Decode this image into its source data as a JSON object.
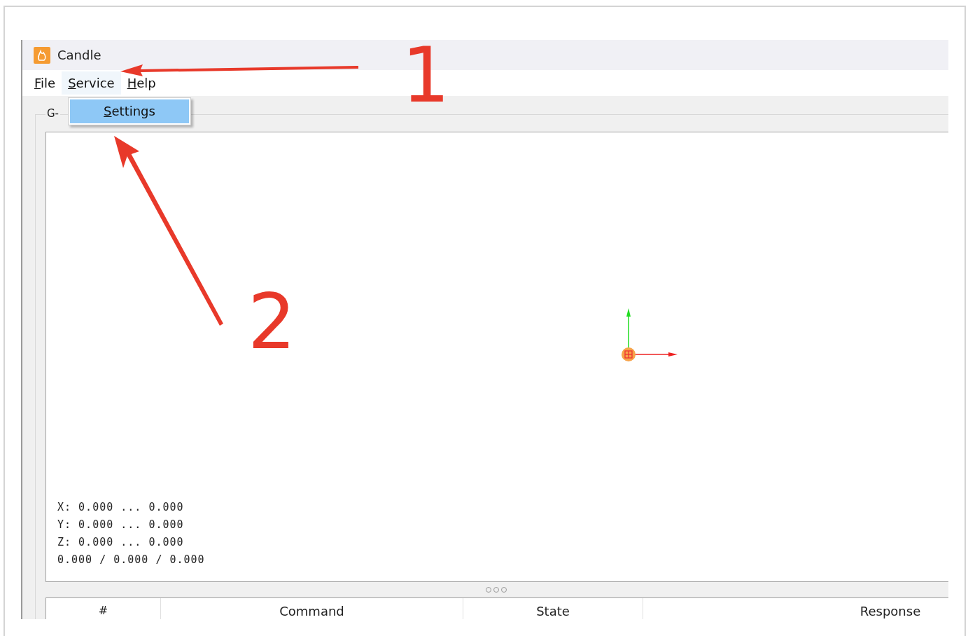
{
  "window": {
    "title": "Candle"
  },
  "menu_bar": [
    {
      "label": "File",
      "mnemonic": true,
      "open": false
    },
    {
      "label": "Service",
      "mnemonic": true,
      "open": true
    },
    {
      "label": "Help",
      "mnemonic": true,
      "open": false
    }
  ],
  "dropdown": [
    {
      "label": "Settings",
      "mnemonic": true,
      "selected": true
    }
  ],
  "group_box": {
    "title": "G-"
  },
  "viewport": {
    "readouts": [
      "X: 0.000 ... 0.000",
      "Y: 0.000 ... 0.000",
      "Z: 0.000 ... 0.000",
      "0.000 / 0.000 / 0.000"
    ]
  },
  "table": {
    "columns": [
      "#",
      "Command",
      "State",
      "Response"
    ]
  },
  "annotations": [
    "1",
    "2"
  ]
}
